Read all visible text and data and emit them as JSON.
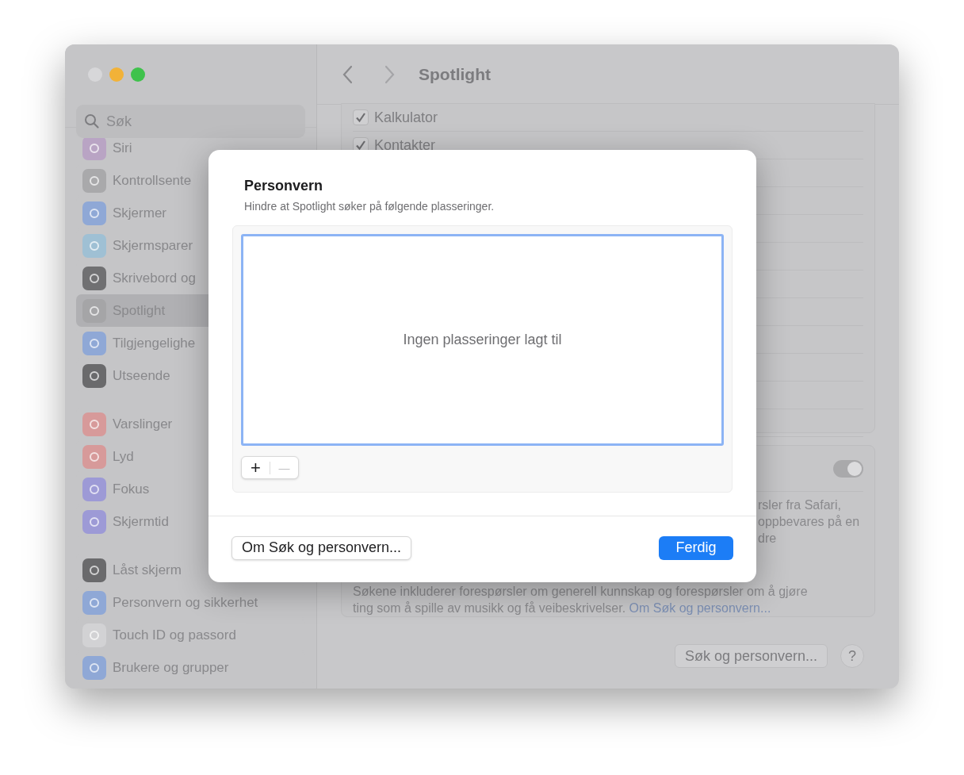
{
  "window": {
    "title": "Spotlight",
    "traffic_lights": [
      {
        "color": "#d7d7d9"
      },
      {
        "color": "#f2b238"
      },
      {
        "color": "#3fc24c"
      }
    ]
  },
  "sidebar": {
    "search": {
      "placeholder": "Søk"
    },
    "groups": [
      [
        {
          "label": "Siri",
          "color": "#b9a4c4",
          "selected": false
        },
        {
          "label": "Kontrollsente",
          "color": "#a9a9ab",
          "selected": false
        },
        {
          "label": "Skjermer",
          "color": "#8fa8d6",
          "selected": false
        },
        {
          "label": "Skjermsparer",
          "color": "#9fc0d4",
          "selected": false
        },
        {
          "label": "Skrivebord og",
          "color": "#707072",
          "selected": false
        },
        {
          "label": "Spotlight",
          "color": "#a5a5a7",
          "selected": true
        },
        {
          "label": "Tilgjengelighe",
          "color": "#8fa8d6",
          "selected": false
        },
        {
          "label": "Utseende",
          "color": "#6a6a6c",
          "selected": false
        }
      ],
      [
        {
          "label": "Varslinger",
          "color": "#d79a9a",
          "selected": false
        },
        {
          "label": "Lyd",
          "color": "#d79a9a",
          "selected": false
        },
        {
          "label": "Fokus",
          "color": "#9d9ad6",
          "selected": false
        },
        {
          "label": "Skjermtid",
          "color": "#9d9ad6",
          "selected": false
        }
      ],
      [
        {
          "label": "Låst skjerm",
          "color": "#6a6a6c",
          "selected": false
        },
        {
          "label": "Personvern og sikkerhet",
          "color": "#8fa8d6",
          "selected": false
        },
        {
          "label": "Touch ID og passord",
          "color": "#d2d2d4",
          "selected": false
        },
        {
          "label": "Brukere og grupper",
          "color": "#8fa8d6",
          "selected": false
        }
      ]
    ]
  },
  "content": {
    "results": [
      {
        "label": "Kalkulator",
        "checked": true
      },
      {
        "label": "Kontakter",
        "checked": true
      }
    ],
    "safari_card": {
      "on": true,
      "lines": [
        "rsler fra Safari,",
        "oppbevares på en",
        "dre"
      ],
      "footer_lines": [
        "Søkene inkluderer forespørsler om generell kunnskap og forespørsler om å gjøre"
      ],
      "last_line": "ting som å spille av musikk og få veibeskrivelser. ",
      "link": "Om Søk og personvern..."
    },
    "privacy_button": "Søk og personvern...",
    "help_button": "?"
  },
  "sheet": {
    "title": "Personvern",
    "subtitle": "Hindre at Spotlight søker på følgende plasseringer.",
    "empty_text": "Ingen plasseringer lagt til",
    "add_button": "+",
    "remove_button": "—",
    "about_button": "Om Søk og personvern...",
    "done_button": "Ferdig"
  }
}
